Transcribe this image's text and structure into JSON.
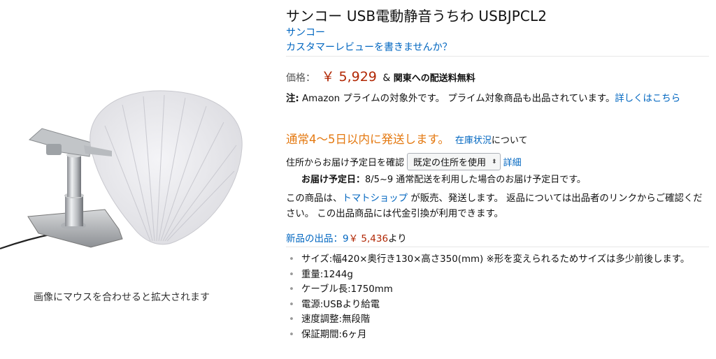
{
  "product": {
    "title": "サンコー USB電動静音うちわ USBJPCL2",
    "brand": "サンコー",
    "review_prompt": "カスタマーレビューを書きませんか？"
  },
  "image": {
    "hover_hint": "画像にマウスを合わせると拡大されます"
  },
  "price": {
    "label": "価格：",
    "amount": "￥ 5,929",
    "amp": "&",
    "shipping": "関東への配送料無料"
  },
  "note": {
    "label": "注:",
    "text": " Amazon プライムの対象外です。 プライム対象商品も出品されています。",
    "link": "詳しくはこちら"
  },
  "stock": {
    "status": "通常4～5日以内に発送します。",
    "link": "在庫状況",
    "after": "について"
  },
  "address": {
    "prefix": "住所からお届け予定日を確認",
    "selected": "既定の住所を使用",
    "details_link": "詳細"
  },
  "delivery": {
    "label": "お届け予定日：",
    "text": "8/5~9 通常配送を利用した場合のお届け予定日です。"
  },
  "seller": {
    "prefix": "この商品は、",
    "name": "トマトショップ",
    "suffix": " が販売、発送します。 返品については出品者のリンクからご確認ください。 この出品商品には代金引換が利用できます。"
  },
  "offers": {
    "label": "新品の出品：9",
    "price": "￥ 5,436",
    "suffix": "より"
  },
  "features": [
    "サイズ:幅420×奥行き130×高さ350(mm) ※形を変えられるためサイズは多少前後します。",
    "重量:1244g",
    "ケーブル長:1750mm",
    "電源:USBより給電",
    "速度調整:無段階",
    "保証期間:6ヶ月"
  ],
  "colors": {
    "link": "#0066c0",
    "price": "#b12704",
    "stock": "#e47911"
  }
}
